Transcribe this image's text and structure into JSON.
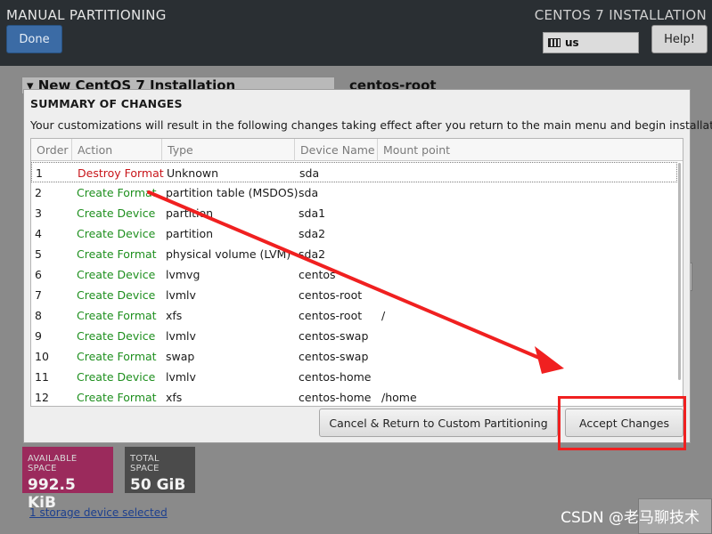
{
  "header": {
    "app_title": "MANUAL PARTITIONING",
    "done_label": "Done",
    "installation_title": "CENTOS 7 INSTALLATION",
    "keyboard_layout": "us",
    "help_label": "Help!"
  },
  "background": {
    "panel_title": "▾ New CentOS 7 Installation",
    "selected_item": "centos-root",
    "available_space_label": "AVAILABLE SPACE",
    "available_space_value": "992.5 KiB",
    "total_space_label": "TOTAL SPACE",
    "total_space_value": "50 GiB",
    "storage_link": "1 storage device selected",
    "watermark": "CSDN @老马聊技术"
  },
  "dialog": {
    "title": "SUMMARY OF CHANGES",
    "description": "Your customizations will result in the following changes taking effect after you return to the main menu and begin installation:",
    "columns": [
      "Order",
      "Action",
      "Type",
      "Device Name",
      "Mount point"
    ],
    "rows": [
      {
        "order": "1",
        "action": "Destroy Format",
        "type": "Unknown",
        "device": "sda",
        "mount": ""
      },
      {
        "order": "2",
        "action": "Create Format",
        "type": "partition table (MSDOS)",
        "device": "sda",
        "mount": ""
      },
      {
        "order": "3",
        "action": "Create Device",
        "type": "partition",
        "device": "sda1",
        "mount": ""
      },
      {
        "order": "4",
        "action": "Create Device",
        "type": "partition",
        "device": "sda2",
        "mount": ""
      },
      {
        "order": "5",
        "action": "Create Format",
        "type": "physical volume (LVM)",
        "device": "sda2",
        "mount": ""
      },
      {
        "order": "6",
        "action": "Create Device",
        "type": "lvmvg",
        "device": "centos",
        "mount": ""
      },
      {
        "order": "7",
        "action": "Create Device",
        "type": "lvmlv",
        "device": "centos-root",
        "mount": ""
      },
      {
        "order": "8",
        "action": "Create Format",
        "type": "xfs",
        "device": "centos-root",
        "mount": "/"
      },
      {
        "order": "9",
        "action": "Create Device",
        "type": "lvmlv",
        "device": "centos-swap",
        "mount": ""
      },
      {
        "order": "10",
        "action": "Create Format",
        "type": "swap",
        "device": "centos-swap",
        "mount": ""
      },
      {
        "order": "11",
        "action": "Create Device",
        "type": "lvmlv",
        "device": "centos-home",
        "mount": ""
      },
      {
        "order": "12",
        "action": "Create Format",
        "type": "xfs",
        "device": "centos-home",
        "mount": "/home"
      }
    ],
    "cancel_label": "Cancel & Return to Custom Partitioning",
    "accept_label": "Accept Changes"
  },
  "colors": {
    "destroy_action": "#c8151a",
    "create_action": "#1e8f1e",
    "annotation_red": "#f02020"
  }
}
